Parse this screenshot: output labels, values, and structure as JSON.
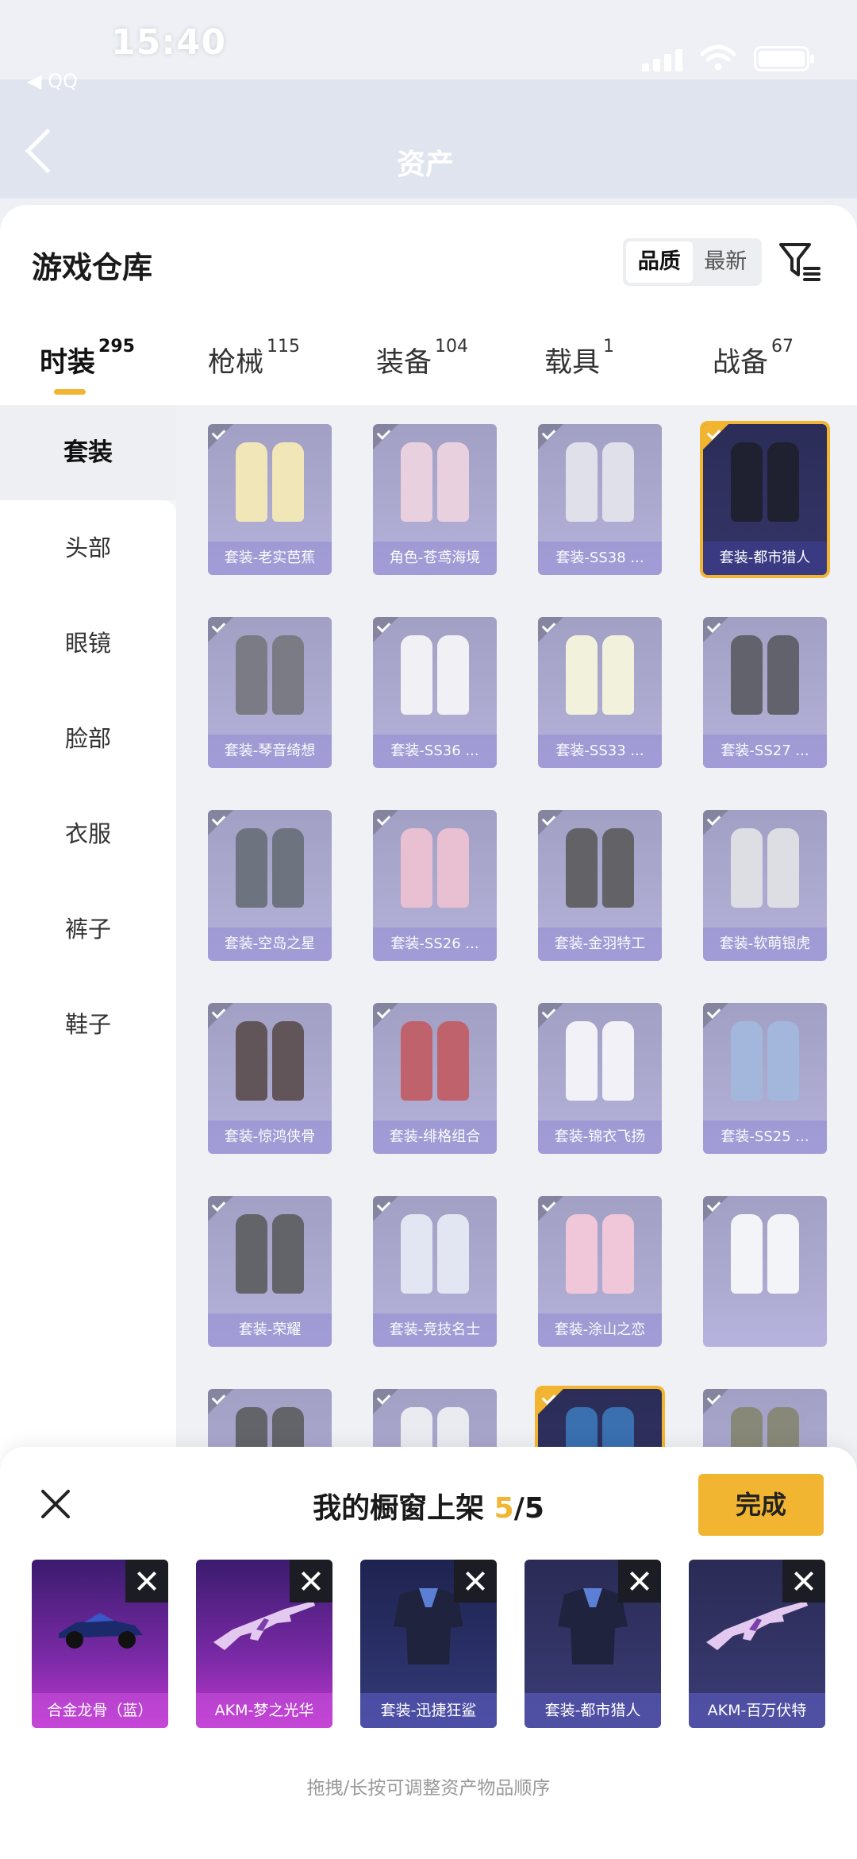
{
  "status_bar": {
    "time": "15:40",
    "back_app": "QQ"
  },
  "nav": {
    "title": "资产"
  },
  "warehouse": {
    "title": "游戏仓库",
    "sort_options": [
      "品质",
      "最新"
    ],
    "active_sort": "品质",
    "filter_icon": "filter-list-icon"
  },
  "tabs": [
    {
      "label": "时装",
      "count": "295"
    },
    {
      "label": "枪械",
      "count": "115"
    },
    {
      "label": "装备",
      "count": "104"
    },
    {
      "label": "载具",
      "count": "1"
    },
    {
      "label": "战备",
      "count": "67"
    }
  ],
  "sidebar": [
    "套装",
    "头部",
    "眼镜",
    "脸部",
    "衣服",
    "裤子",
    "鞋子"
  ],
  "items": [
    {
      "label": "套装-老实芭蕉",
      "selected": false,
      "color": "#f0e3a8"
    },
    {
      "label": "角色-苍鸢海境",
      "selected": false,
      "color": "#e8c7d8"
    },
    {
      "label": "套装-SS38 ...",
      "selected": false,
      "color": "#dcdce8"
    },
    {
      "label": "套装-都市猎人",
      "selected": true,
      "color": "#1f2030"
    },
    {
      "label": "套装-琴音绮想",
      "selected": false,
      "color": "#5b5b66"
    },
    {
      "label": "套装-SS36 ...",
      "selected": false,
      "color": "#f2f2f6"
    },
    {
      "label": "套装-SS33 ...",
      "selected": false,
      "color": "#f3f3d6"
    },
    {
      "label": "套装-SS27 ...",
      "selected": false,
      "color": "#3a3a45"
    },
    {
      "label": "套装-空岛之星",
      "selected": false,
      "color": "#4a5060"
    },
    {
      "label": "套装-SS26 ...",
      "selected": false,
      "color": "#e7b3c9"
    },
    {
      "label": "套装-金羽特工",
      "selected": false,
      "color": "#3b3b40"
    },
    {
      "label": "套装-软萌银虎",
      "selected": false,
      "color": "#d8d8e0"
    },
    {
      "label": "套装-惊鸿侠骨",
      "selected": false,
      "color": "#3a2a2e"
    },
    {
      "label": "套装-绯格组合",
      "selected": false,
      "color": "#b33a46"
    },
    {
      "label": "套装-锦衣飞扬",
      "selected": false,
      "color": "#f2f2f8"
    },
    {
      "label": "套装-SS25 ...",
      "selected": false,
      "color": "#8ea8d6"
    },
    {
      "label": "套装-荣耀",
      "selected": false,
      "color": "#3c3c44"
    },
    {
      "label": "套装-竞技名士",
      "selected": false,
      "color": "#dfe4f2"
    },
    {
      "label": "套装-涂山之恋",
      "selected": false,
      "color": "#f0bcd0"
    },
    {
      "label": "",
      "selected": false,
      "color": "#f5f5fa"
    },
    {
      "label": "",
      "selected": false,
      "color": "#3c3c44"
    },
    {
      "label": "",
      "selected": false,
      "color": "#e9e9f0"
    },
    {
      "label": "",
      "selected": true,
      "color": "#3a6fb0"
    },
    {
      "label": "",
      "selected": false,
      "color": "#6b6b55"
    }
  ],
  "panel": {
    "title_prefix": "我的橱窗上架",
    "count_current": "5",
    "count_total": "/5",
    "done": "完成",
    "hint": "拖拽/长按可调整资产物品顺序",
    "shelf": [
      {
        "label": "合金龙骨（蓝）",
        "icon": "race-car-icon",
        "style": "purple"
      },
      {
        "label": "AKM-梦之光华",
        "icon": "rifle-icon",
        "style": "purple"
      },
      {
        "label": "套装-迅捷狂鲨",
        "icon": "outfit-icon",
        "style": "blue"
      },
      {
        "label": "套装-都市猎人",
        "icon": "outfit-icon",
        "style": "dark"
      },
      {
        "label": "AKM-百万伏特",
        "icon": "rifle-icon",
        "style": "dark"
      }
    ]
  },
  "colors": {
    "accent": "#f2b531"
  }
}
